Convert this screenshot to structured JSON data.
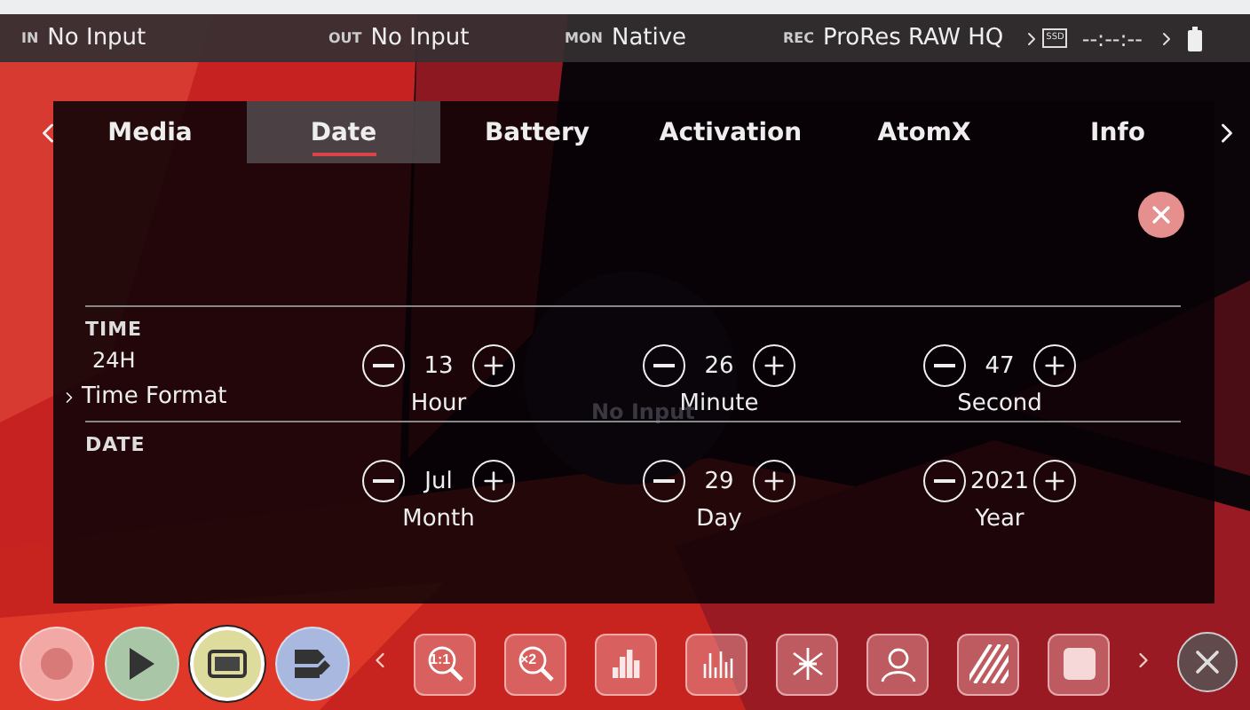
{
  "status_bar": [
    {
      "label": "IN",
      "value": "No Input"
    },
    {
      "label": "OUT",
      "value": "No Input"
    },
    {
      "label": "MON",
      "value": "Native"
    },
    {
      "label": "REC",
      "value": "ProRes RAW HQ"
    }
  ],
  "storage": {
    "badge": "SSD",
    "timecode": "--:--:--"
  },
  "background_label": "No Input",
  "tabs": [
    {
      "label": "Media",
      "selected": false
    },
    {
      "label": "Date",
      "selected": true
    },
    {
      "label": "Battery",
      "selected": false
    },
    {
      "label": "Activation",
      "selected": false
    },
    {
      "label": "AtomX",
      "selected": false
    },
    {
      "label": "Info",
      "selected": false
    }
  ],
  "sections": [
    {
      "title": "TIME",
      "setting": {
        "value": "24H",
        "label": "Time Format"
      },
      "fields": [
        {
          "value": "13",
          "label": "Hour"
        },
        {
          "value": "26",
          "label": "Minute"
        },
        {
          "value": "47",
          "label": "Second"
        }
      ]
    },
    {
      "title": "DATE",
      "fields": [
        {
          "value": "Jul",
          "label": "Month"
        },
        {
          "value": "29",
          "label": "Day"
        },
        {
          "value": "2021",
          "label": "Year"
        }
      ]
    }
  ],
  "transport": [
    {
      "kind": "record",
      "color": "#f2a8a5",
      "selected": false
    },
    {
      "kind": "play",
      "color": "#a9c6a6",
      "selected": false
    },
    {
      "kind": "display",
      "color": "#dedc9c",
      "selected": true
    },
    {
      "kind": "tags",
      "color": "#a9b8de",
      "selected": false
    }
  ],
  "tools": [
    {
      "kind": "zoom",
      "label": "1:1"
    },
    {
      "kind": "zoom",
      "label": "×2"
    },
    {
      "kind": "histogram"
    },
    {
      "kind": "waveform"
    },
    {
      "kind": "vectorscope"
    },
    {
      "kind": "focus"
    },
    {
      "kind": "zebra"
    },
    {
      "kind": "blank"
    }
  ]
}
